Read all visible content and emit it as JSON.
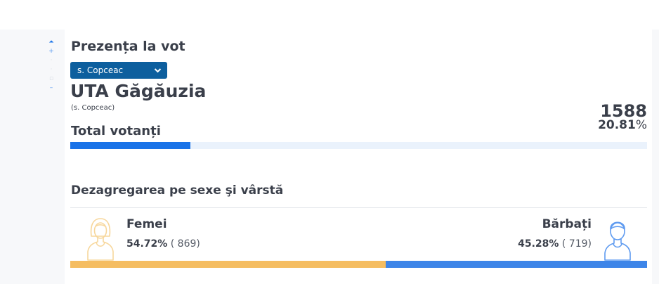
{
  "colors": {
    "accent": "#1a73e8",
    "select_bg": "#0d5f9e",
    "female": "#f5bd61",
    "male": "#3d85e8",
    "track": "#eaf2fc"
  },
  "rail": {
    "icons": [
      "arrow-up-icon",
      "plus-icon",
      "dot-icon",
      "dot-icon",
      "square-icon",
      "minus-icon"
    ]
  },
  "page": {
    "heading": "Prezența la vot"
  },
  "locality_select": {
    "selected": "s. Copceac",
    "chevron": "⌄"
  },
  "region": {
    "title": "UTA Găgăuzia",
    "subtitle": "(s. Copceac)"
  },
  "turnout": {
    "label": "Total votanți",
    "count": "1588",
    "percent_value": "20.81",
    "percent_sign": "%",
    "fraction": 0.2081
  },
  "breakdown": {
    "title": "Dezagregarea pe sexe şi vârstă",
    "female": {
      "label": "Femei",
      "percent": "54.72%",
      "count": "( 869)",
      "fraction": 0.5472
    },
    "male": {
      "label": "Bărbați",
      "percent": "45.28%",
      "count": "( 719)",
      "fraction": 0.4528
    }
  }
}
